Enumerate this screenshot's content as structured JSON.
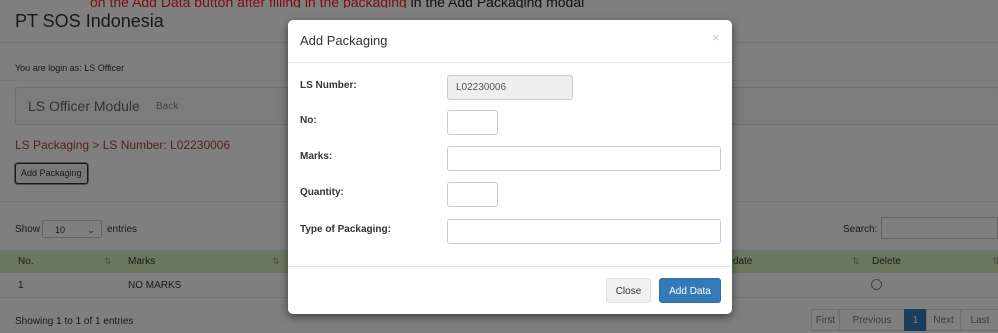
{
  "top_strip": {
    "red_text": "on the Add Data button after filling in the packaging",
    "black_text": " in the Add Packaging modal"
  },
  "app": {
    "title": "PT SOS Indonesia",
    "login_text": "You are login as: LS Officer"
  },
  "module": {
    "title": "LS Officer Module",
    "back_label": "Back"
  },
  "breadcrumb": "LS Packaging > LS Number: L02230006",
  "add_packaging_button": "Add Packaging",
  "table_controls": {
    "show_label": "Show",
    "page_size": "10",
    "entries_label": "entries",
    "search_label": "Search:"
  },
  "table": {
    "columns": [
      "No.",
      "Marks",
      "date",
      "Delete"
    ],
    "rows": [
      {
        "no": "1",
        "marks": "NO MARKS"
      }
    ]
  },
  "footer": {
    "info": "Showing 1 to 1 of 1 entries"
  },
  "pagination": {
    "first": "First",
    "previous": "Previous",
    "current": "1",
    "next": "Next",
    "last": "Last"
  },
  "modal": {
    "title": "Add Packaging",
    "close_symbol": "×",
    "fields": {
      "ls_number": {
        "label": "LS Number:",
        "value": "L02230006"
      },
      "no": {
        "label": "No:",
        "value": ""
      },
      "marks": {
        "label": "Marks:",
        "value": ""
      },
      "quantity": {
        "label": "Quantity:",
        "value": ""
      },
      "type_of_packaging": {
        "label": "Type of Packaging:",
        "value": ""
      }
    },
    "close_button": "Close",
    "add_data_button": "Add Data"
  },
  "colors": {
    "primary": "#337ab7",
    "table_header": "#d6f0c0",
    "breadcrumb": "#a94442",
    "backdrop": "rgba(0,0,0,0.5)"
  }
}
